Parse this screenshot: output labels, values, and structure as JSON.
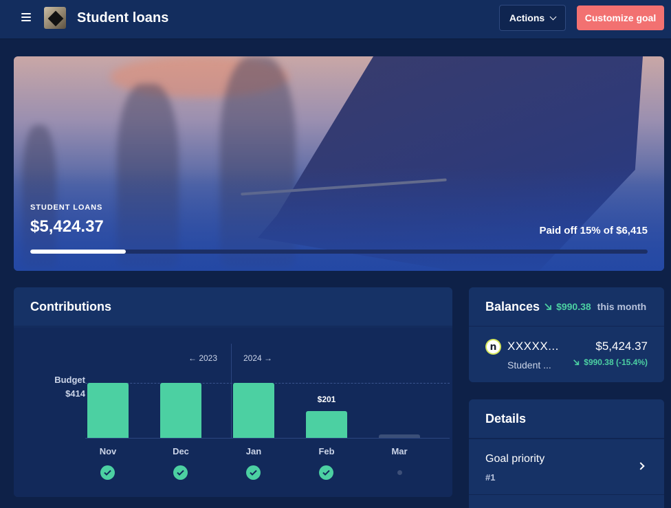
{
  "header": {
    "title": "Student loans",
    "actions_label": "Actions",
    "customize_label": "Customize goal"
  },
  "hero": {
    "label": "STUDENT LOANS",
    "amount": "$5,424.37",
    "paid_text": "Paid off 15% of $6,415",
    "progress_fraction": 0.155
  },
  "contributions": {
    "title": "Contributions",
    "budget_label": "Budget",
    "budget_value": "$414",
    "year_left": "← 2023",
    "year_right": "2024 →"
  },
  "chart_data": {
    "type": "bar",
    "categories": [
      "Nov",
      "Dec",
      "Jan",
      "Feb",
      "Mar"
    ],
    "values": [
      414,
      414,
      414,
      201,
      0
    ],
    "data_labels": [
      "",
      "",
      "",
      "$201",
      ""
    ],
    "budget": 414,
    "status": [
      "complete",
      "complete",
      "complete",
      "complete",
      "pending"
    ],
    "ylim": [
      0,
      414
    ]
  },
  "balances": {
    "title": "Balances",
    "change": "$990.38",
    "period": "this month",
    "account": {
      "logo_letter": "n",
      "name": "XXXXX...",
      "type": "Student ...",
      "amount": "$5,424.37",
      "change": "$990.38 (-15.4%)"
    }
  },
  "details": {
    "title": "Details",
    "rows": [
      {
        "label": "Goal priority",
        "value": "#1"
      }
    ]
  },
  "colors": {
    "accent_green": "#4cd0a2",
    "customize_button": "#f27171",
    "background": "#0e2148"
  }
}
